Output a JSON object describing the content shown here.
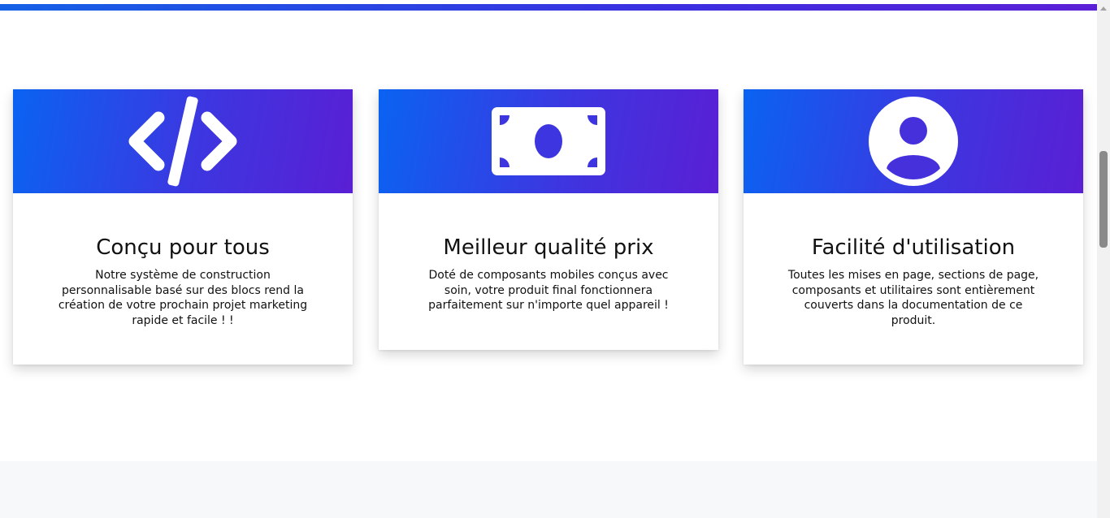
{
  "features": [
    {
      "icon": "code-icon",
      "title": "Conçu pour tous",
      "text": "Notre système de construction personnalisable basé sur des blocs rend la création de votre prochain projet marketing rapide et facile ! !"
    },
    {
      "icon": "banknote-icon",
      "title": "Meilleur qualité prix",
      "text": "Doté de composants mobiles conçus avec soin, votre produit final fonctionnera parfaitement sur n'importe quel appareil !"
    },
    {
      "icon": "user-circle-icon",
      "title": "Facilité d'utilisation",
      "text": "Toutes les mises en page, sections de page, composants et utilitaires sont entièrement couverts dans la documentation de ce produit."
    }
  ],
  "colors": {
    "gradient_start": "#0a63f2",
    "gradient_end": "#5a1fd4",
    "card_background": "#ffffff",
    "footer_band": "#f6f8fa"
  }
}
